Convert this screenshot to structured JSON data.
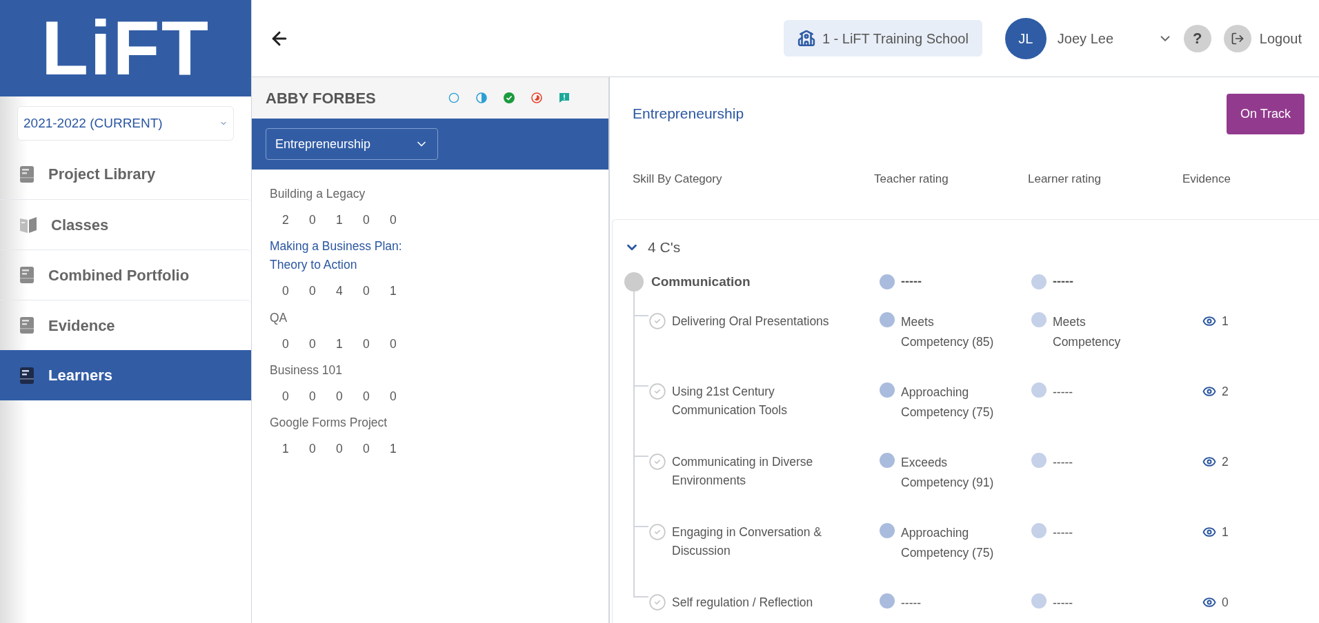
{
  "sidebar": {
    "logo": "LiFT",
    "year_select": {
      "value": "2021-2022 (CURRENT)"
    },
    "items": [
      {
        "label": "Project Library",
        "kind": "book",
        "selected": false
      },
      {
        "label": "Classes",
        "kind": "open-book",
        "selected": false
      },
      {
        "label": "Combined Portfolio",
        "kind": "book",
        "selected": false
      },
      {
        "label": "Evidence",
        "kind": "book",
        "selected": false
      },
      {
        "label": "Learners",
        "kind": "book",
        "selected": true
      }
    ]
  },
  "topbar": {
    "school": "1 - LiFT Training School",
    "user": {
      "initials": "JL",
      "name": "Joey Lee"
    },
    "help": "?",
    "logout": "Logout"
  },
  "learner": {
    "name": "ABBY FORBES",
    "subject_select": {
      "value": "Entrepreneurship"
    },
    "projects": [
      {
        "title": "Building a Legacy",
        "selected": false,
        "counts": [
          "2",
          "0",
          "1",
          "0",
          "0"
        ]
      },
      {
        "title": "Making a Business Plan: Theory to Action",
        "selected": true,
        "counts": [
          "0",
          "0",
          "4",
          "0",
          "1"
        ]
      },
      {
        "title": "QA",
        "selected": false,
        "counts": [
          "0",
          "0",
          "1",
          "0",
          "0"
        ]
      },
      {
        "title": "Business 101",
        "selected": false,
        "counts": [
          "0",
          "0",
          "0",
          "0",
          "0"
        ]
      },
      {
        "title": "Google Forms Project",
        "selected": false,
        "counts": [
          "1",
          "0",
          "0",
          "0",
          "1"
        ]
      }
    ]
  },
  "skills": {
    "title": "Entrepreneurship",
    "status": "On Track",
    "columns": [
      "Skill By Category",
      "Teacher rating",
      "Learner rating",
      "Evidence"
    ],
    "categories": [
      {
        "name": "4 C's",
        "expanded": true,
        "skills": [
          {
            "name": "Communication",
            "teacher_rating": "-----",
            "learner_rating": "-----",
            "children": [
              {
                "name": "Delivering Oral Presentations",
                "teacher_rating": "Meets Competency (85)",
                "learner_rating": "Meets Competency",
                "evidence": "1"
              },
              {
                "name": "Using 21st Century Communication Tools",
                "teacher_rating": "Approaching Competency (75)",
                "learner_rating": "-----",
                "evidence": "2"
              },
              {
                "name": "Communicating in Diverse Environments",
                "teacher_rating": "Exceeds Competency (91)",
                "learner_rating": "-----",
                "evidence": "2"
              },
              {
                "name": "Engaging in Conversation & Discussion",
                "teacher_rating": "Approaching Competency (75)",
                "learner_rating": "-----",
                "evidence": "1"
              },
              {
                "name": "Self regulation / Reflection",
                "teacher_rating": "-----",
                "learner_rating": "-----",
                "evidence": "0"
              }
            ]
          }
        ]
      }
    ]
  }
}
